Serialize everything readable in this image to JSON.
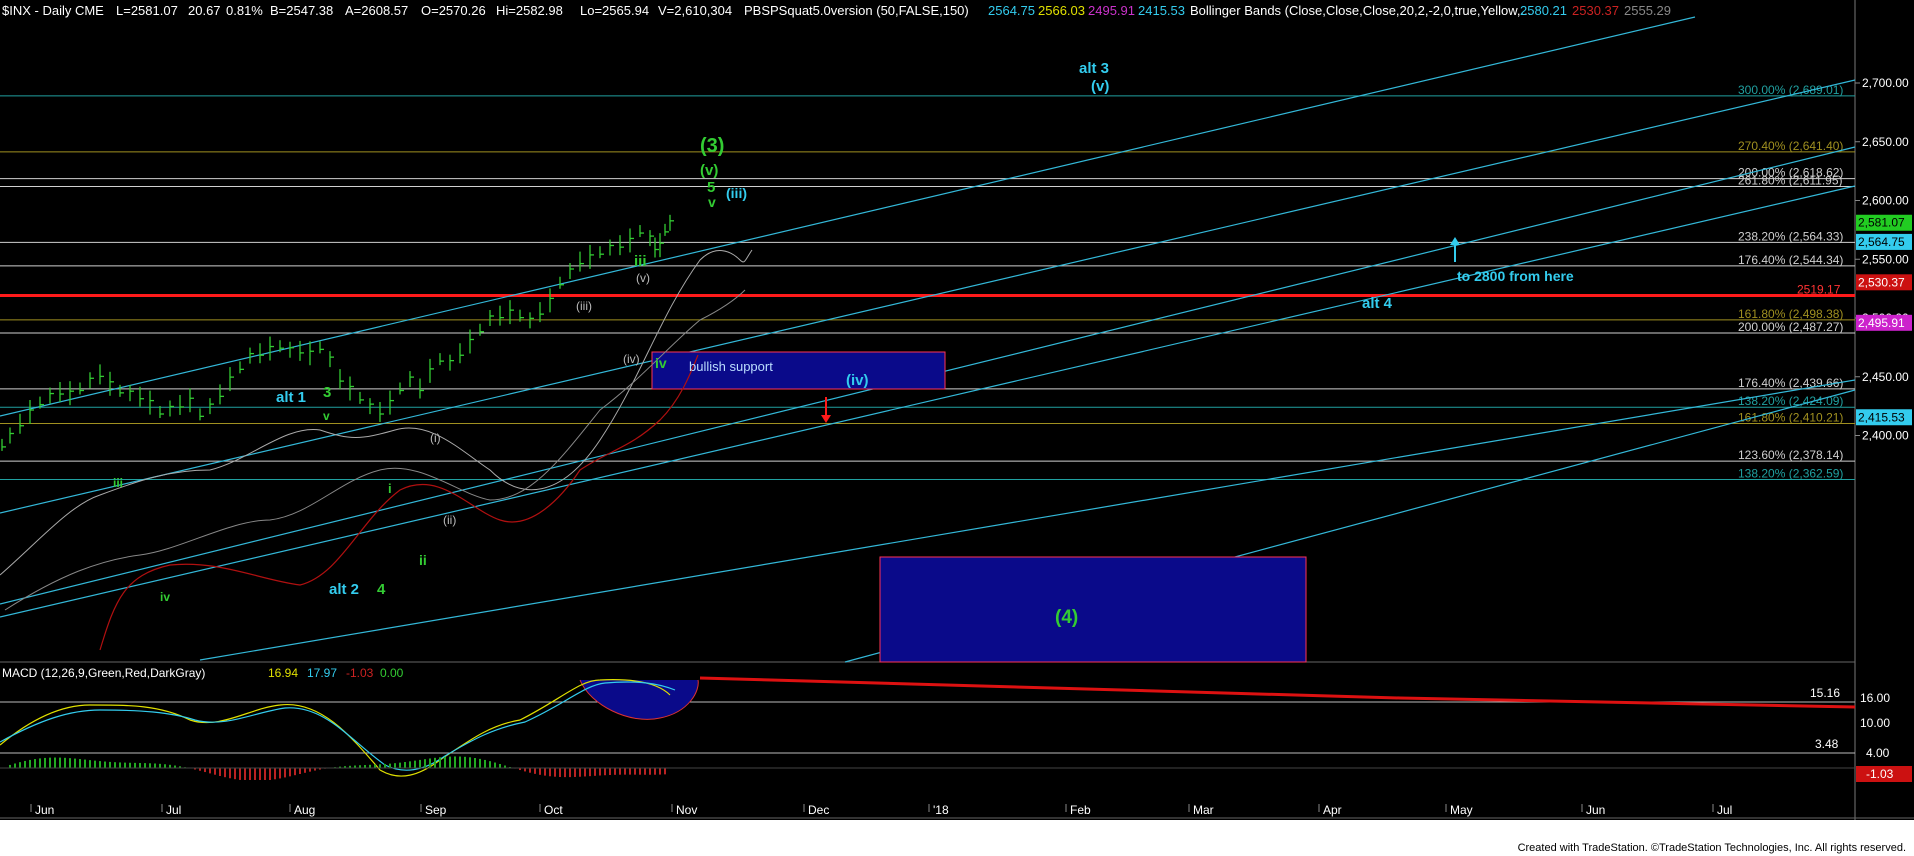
{
  "header": {
    "symbol": "$INX - Daily  CME",
    "last": "L=2581.07",
    "change": "20.67",
    "pct": "0.81%",
    "bid": "B=2547.38",
    "ask": "A=2608.57",
    "open": "O=2570.26",
    "high": "Hi=2582.98",
    "low": "Lo=2565.94",
    "volume": "V=2,610,304",
    "study1": "PBSPSquat5.0version (50,FALSE,150)",
    "study1_vals": [
      "2564.75",
      "2566.03",
      "2495.91",
      "2415.53"
    ],
    "study2": "Bollinger Bands (Close,Close,Close,20,2,-2,0,true,Yellow,...",
    "study2_vals": [
      "2580.21",
      "2530.37",
      "2555.29"
    ]
  },
  "colors": {
    "background": "#000000",
    "cyan": "#33ccee",
    "green": "#33cc33",
    "red": "#ff1a1a",
    "darkred": "#b01010",
    "blue_box": "#0a0a8a",
    "fib_gray": "#c0c0c0",
    "fib_yellow": "#b0a020"
  },
  "chart_data": [
    {
      "type": "line",
      "title": "$INX - Daily CME",
      "y_axis": {
        "ticks": [
          "2,700.00",
          "2,650.00",
          "2,600.00",
          "2,550.00",
          "2,500.00",
          "2,450.00",
          "2,400.00"
        ],
        "range": [
          2358,
          2720
        ]
      },
      "x_axis": {
        "ticks": [
          "Jun",
          "Jul",
          "Aug",
          "Sep",
          "Oct",
          "Nov",
          "Dec",
          "'18",
          "Feb",
          "Mar",
          "Apr",
          "May",
          "Jun",
          "Jul"
        ]
      },
      "price_markers": [
        {
          "label": "2,581.07",
          "value": 2581.07,
          "color": "#22cc22",
          "text_color": "#000000"
        },
        {
          "label": "2,564.75",
          "value": 2564.75,
          "color": "#33ccee",
          "text_color": "#000000"
        },
        {
          "label": "2,530.37",
          "value": 2530.37,
          "color": "#cc1111",
          "text_color": "#ffffff"
        },
        {
          "label": "2,495.91",
          "value": 2495.91,
          "color": "#cc22cc",
          "text_color": "#ffffff"
        },
        {
          "label": "2,415.53",
          "value": 2415.53,
          "color": "#33ccee",
          "text_color": "#000000"
        }
      ],
      "fib_levels": [
        {
          "label": "300.00% (2,689.01)",
          "value": 2689.01,
          "color": "#20a0a0"
        },
        {
          "label": "270.40% (2,641.40)",
          "value": 2641.4,
          "color": "#a09020"
        },
        {
          "label": "200.00% (2,618.62)",
          "value": 2618.62,
          "color": "#d0d0d0"
        },
        {
          "label": "261.80% (2,611.95)",
          "value": 2611.95,
          "color": "#d0d0d0"
        },
        {
          "label": "238.20% (2,564.33)",
          "value": 2564.33,
          "color": "#d0d0d0"
        },
        {
          "label": "176.40% (2,544.34)",
          "value": 2544.34,
          "color": "#d0d0d0"
        },
        {
          "label": "2519.17",
          "value": 2519.17,
          "color": "#ff1a1a"
        },
        {
          "label": "161.80% (2,498.38)",
          "value": 2498.38,
          "color": "#a09020"
        },
        {
          "label": "200.00% (2,487.27)",
          "value": 2487.27,
          "color": "#d0d0d0"
        },
        {
          "label": "176.40% (2,439.66)",
          "value": 2439.66,
          "color": "#d0d0d0"
        },
        {
          "label": "138.20% (2,424.09)",
          "value": 2424.09,
          "color": "#20a0a0"
        },
        {
          "label": "161.80% (2,410.21)",
          "value": 2410.21,
          "color": "#a09020"
        },
        {
          "label": "123.60% (2,378.14)",
          "value": 2378.14,
          "color": "#d0d0d0"
        },
        {
          "label": "138.20% (2,362.59)",
          "value": 2362.59,
          "color": "#20a0a0"
        }
      ],
      "wave_labels": [
        {
          "text": "alt 3",
          "color": "#33ccee"
        },
        {
          "text": "(v)",
          "color": "#33ccee"
        },
        {
          "text": "(3)",
          "color": "#33cc33"
        },
        {
          "text": "(v)",
          "color": "#33cc33"
        },
        {
          "text": "5",
          "color": "#33cc33"
        },
        {
          "text": "v",
          "color": "#33cc33"
        },
        {
          "text": "(iii)",
          "color": "#33ccee"
        },
        {
          "text": "iii",
          "color": "#33cc33"
        },
        {
          "text": "(v)",
          "color": "#bbbbbb"
        },
        {
          "text": "(iii)",
          "color": "#bbbbbb"
        },
        {
          "text": "(iv)",
          "color": "#bbbbbb"
        },
        {
          "text": "iv",
          "color": "#33cc33"
        },
        {
          "text": "bullish support",
          "color": "#bbddff"
        },
        {
          "text": "(iv)",
          "color": "#33ccee"
        },
        {
          "text": "alt 1",
          "color": "#33ccee"
        },
        {
          "text": "3",
          "color": "#33cc33"
        },
        {
          "text": "v",
          "color": "#33cc33"
        },
        {
          "text": "(i)",
          "color": "#bbbbbb"
        },
        {
          "text": "iii",
          "color": "#33cc33"
        },
        {
          "text": "i",
          "color": "#33cc33"
        },
        {
          "text": "(ii)",
          "color": "#bbbbbb"
        },
        {
          "text": "ii",
          "color": "#33cc33"
        },
        {
          "text": "iv",
          "color": "#33cc33"
        },
        {
          "text": "alt 2",
          "color": "#33ccee"
        },
        {
          "text": "4",
          "color": "#33cc33"
        },
        {
          "text": "(4)",
          "color": "#33cc33"
        },
        {
          "text": "to 2800 from here",
          "color": "#33ccee"
        },
        {
          "text": "alt 4",
          "color": "#33ccee"
        }
      ]
    },
    {
      "type": "line",
      "title": "MACD (12,26,9,Green,Red,DarkGray)",
      "values_text": [
        "16.94",
        "17.97",
        "-1.03",
        "0.00"
      ],
      "y_axis": {
        "ticks": [
          "16.00",
          "10.00",
          "4.00"
        ]
      },
      "markers": [
        {
          "label": "15.16",
          "color": "none"
        },
        {
          "label": "3.48",
          "color": "none"
        },
        {
          "label": "-1.03",
          "color": "#cc1111"
        }
      ]
    }
  ],
  "footer": {
    "credit": "Created with TradeStation. ©TradeStation Technologies, Inc. All rights reserved."
  }
}
